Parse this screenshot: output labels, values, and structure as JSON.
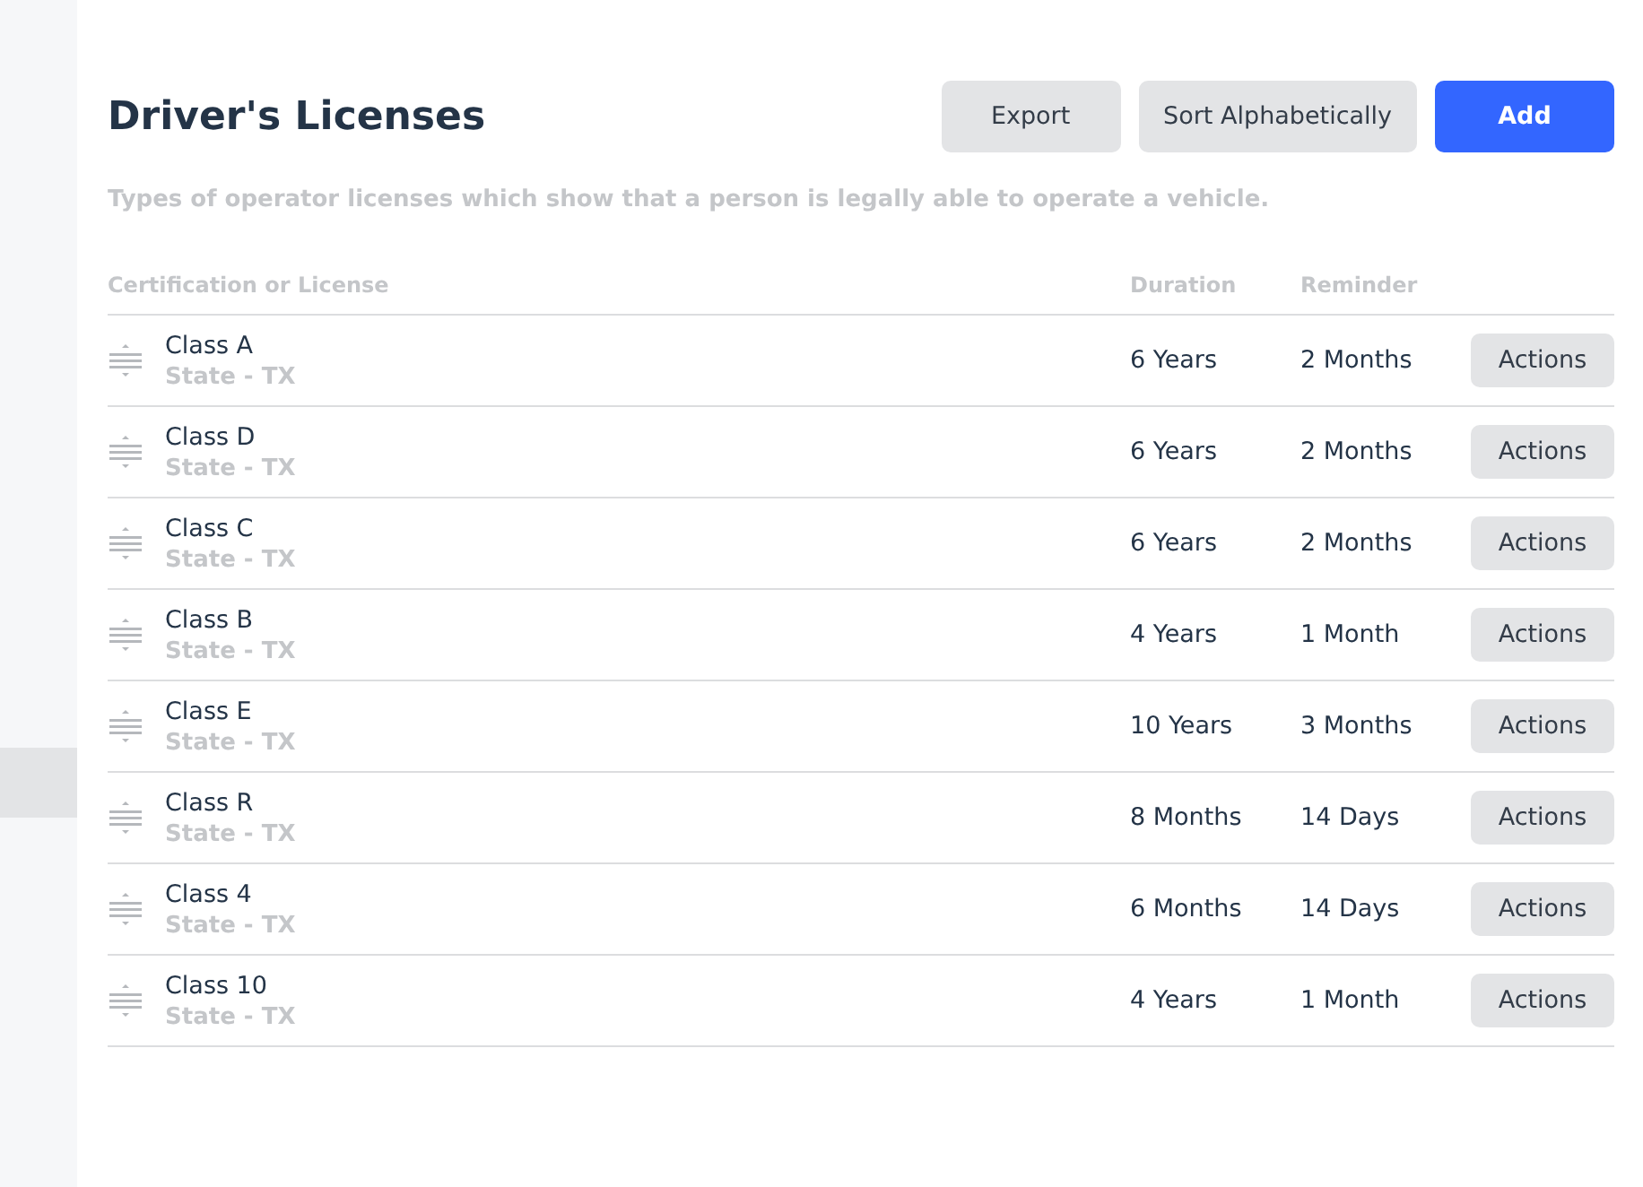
{
  "header": {
    "title": "Driver's Licenses",
    "buttons": [
      {
        "label": "Export",
        "kind": "secondary"
      },
      {
        "label": "Sort Alphabetically",
        "kind": "secondary"
      },
      {
        "label": "Add",
        "kind": "primary"
      }
    ]
  },
  "description": "Types of operator licenses which show that a person is legally able to operate a vehicle.",
  "table": {
    "columns": [
      "Certification or License",
      "Duration",
      "Reminder"
    ],
    "rows": [
      {
        "name": "Class A",
        "issuer": "State - TX",
        "duration": "6 Years",
        "reminder": "2 Months",
        "action": "Actions"
      },
      {
        "name": "Class D",
        "issuer": "State - TX",
        "duration": "6 Years",
        "reminder": "2 Months",
        "action": "Actions"
      },
      {
        "name": "Class C",
        "issuer": "State - TX",
        "duration": "6 Years",
        "reminder": "2 Months",
        "action": "Actions"
      },
      {
        "name": "Class B",
        "issuer": "State - TX",
        "duration": "4 Years",
        "reminder": "1 Month",
        "action": "Actions"
      },
      {
        "name": "Class E",
        "issuer": "State - TX",
        "duration": "10 Years",
        "reminder": "3 Months",
        "action": "Actions"
      },
      {
        "name": "Class R",
        "issuer": "State - TX",
        "duration": "8 Months",
        "reminder": "14 Days",
        "action": "Actions"
      },
      {
        "name": "Class 4",
        "issuer": "State - TX",
        "duration": "6 Months",
        "reminder": "14 Days",
        "action": "Actions"
      },
      {
        "name": "Class 10",
        "issuer": "State - TX",
        "duration": "4 Years",
        "reminder": "1 Month",
        "action": "Actions"
      }
    ]
  }
}
